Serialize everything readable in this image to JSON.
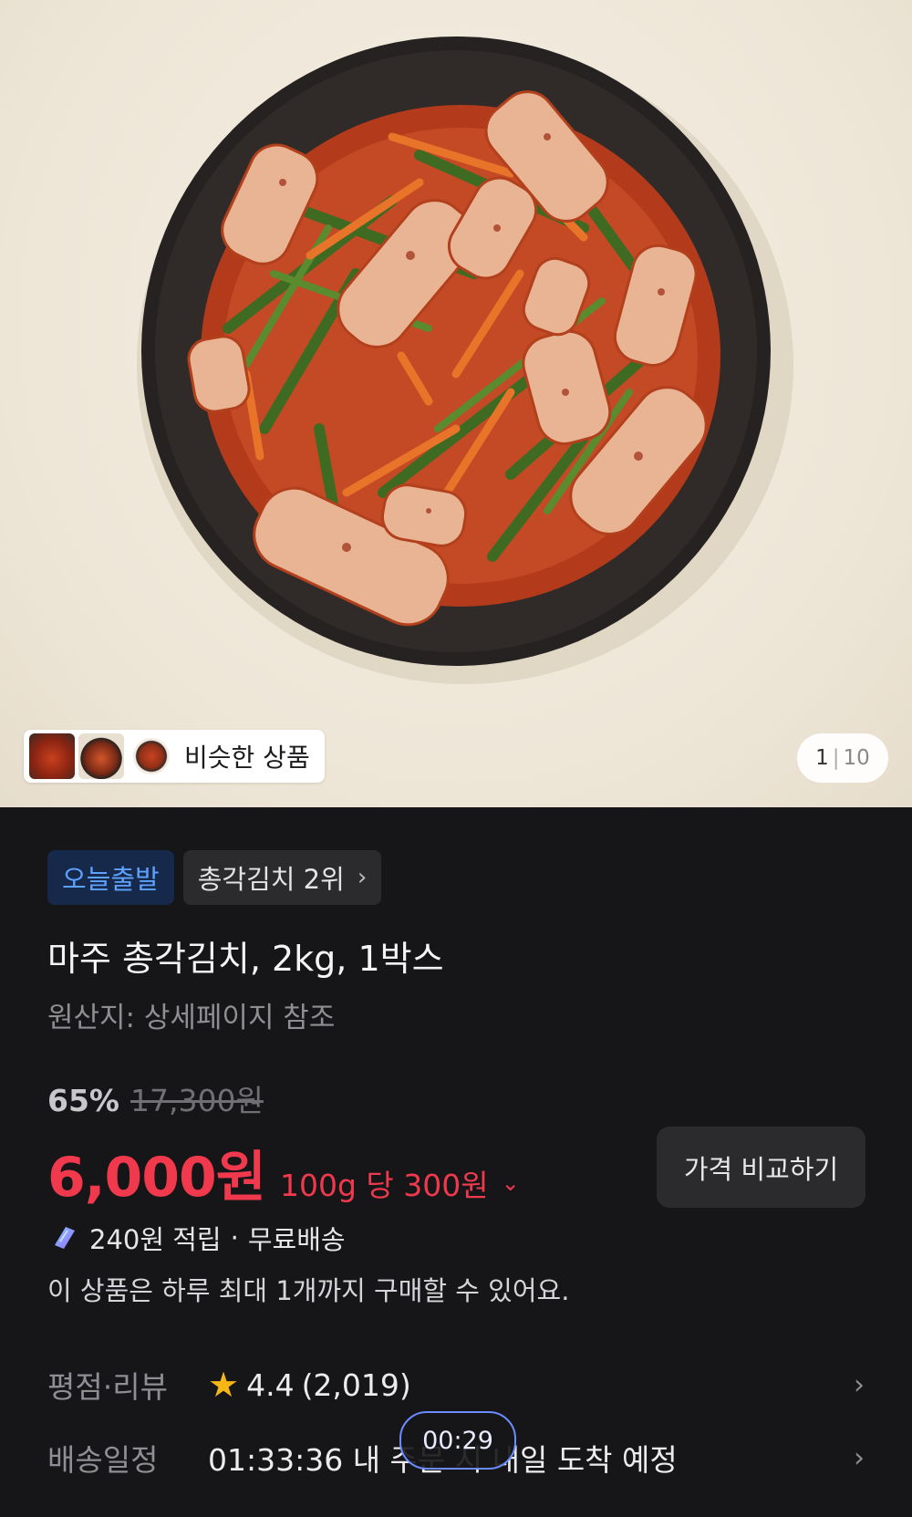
{
  "gallery": {
    "similar_label": "비슷한 상품",
    "page_current": "1",
    "page_separator": "|",
    "page_total": "10"
  },
  "badges": {
    "today_departure": "오늘출발",
    "category_rank": "총각김치 2위"
  },
  "product": {
    "title": "마주 총각김치, 2kg, 1박스",
    "origin": "원산지: 상세페이지 참조"
  },
  "pricing": {
    "discount": "65%",
    "original_price": "17,300원",
    "sale_price": "6,000원",
    "unit_price": "100g 당 300원",
    "compare_button": "가격 비교하기"
  },
  "benefits": {
    "reward": "240원 적립",
    "dot": "·",
    "shipping": "무료배송",
    "limit_note": "이 상품은 하루 최대 1개까지 구매할 수 있어요."
  },
  "rating_row": {
    "label": "평점·리뷰",
    "rating": "4.4",
    "count": "(2,019)"
  },
  "shipping_row": {
    "label": "배송일정",
    "value": "01:33:36 내 주문 시 내일 도착 예정"
  },
  "timer": {
    "value": "00:29"
  },
  "colors": {
    "sale_red": "#f0394d",
    "today_badge_text": "#5ea2ff",
    "star": "#f6b716",
    "background": "#161618"
  }
}
